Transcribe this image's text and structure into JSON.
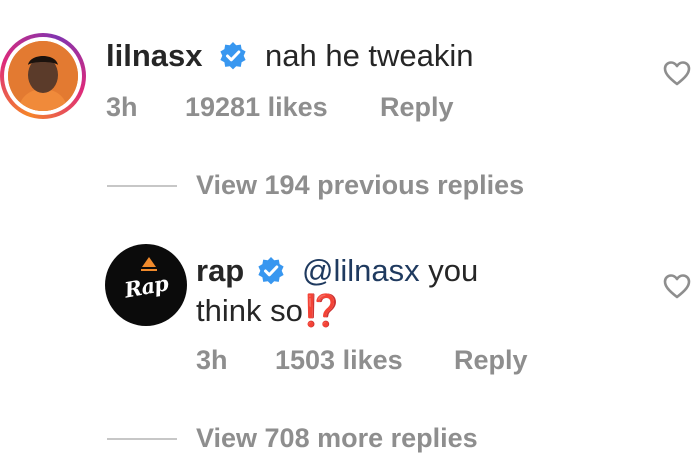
{
  "comment1": {
    "username": "lilnasx",
    "text": "nah he tweakin",
    "time": "3h",
    "likes": "19281 likes",
    "reply_label": "Reply",
    "avatar_icon": "profile-photo",
    "ring_color": "#dd2a7b"
  },
  "view_previous": {
    "label": "View 194 previous replies"
  },
  "comment2": {
    "username": "rap",
    "mention": "@lilnasx",
    "text_line1_rest": " you",
    "text_line2": "think so",
    "emoji": "⁉️",
    "time": "3h",
    "likes": "1503 likes",
    "reply_label": "Reply",
    "avatar_logo_text": "Rap",
    "avatar_icon": "rap-logo"
  },
  "view_more": {
    "label": "View 708 more replies"
  },
  "colors": {
    "verified": "#3897f0",
    "meta": "#8e8e8e",
    "emoji": "#d21b1b"
  }
}
